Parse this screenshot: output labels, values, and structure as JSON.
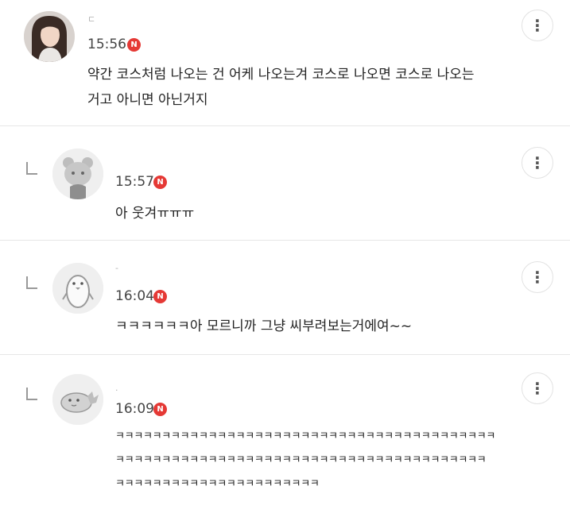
{
  "comments": [
    {
      "author": "ㄷ",
      "time": "15:56",
      "badge": "N",
      "text": "약간 코스처럼 나오는 건 어케 나오는겨 코스로 나오면 코스로 나오는\n거고 아니면 아닌거지",
      "avatar": "profile-photo"
    },
    {
      "author": "",
      "time": "15:57",
      "badge": "N",
      "text": "아 웃겨ㅠㅠㅠ",
      "avatar": "bear-character"
    },
    {
      "author": "-",
      "time": "16:04",
      "badge": "N",
      "text": "ㅋㅋㅋㅋㅋㅋ아 모르니까 그냥 씨부려보는거에여~~",
      "avatar": "penguin-character"
    },
    {
      "author": "·",
      "time": "16:09",
      "badge": "N",
      "text": "ㅋㅋㅋㅋㅋㅋㅋㅋㅋㅋㅋㅋㅋㅋㅋㅋㅋㅋㅋㅋㅋㅋㅋㅋㅋㅋㅋㅋㅋㅋㅋㅋㅋㅋㅋㅋㅋㅋㅋㅋㅋ\nㅋㅋㅋㅋㅋㅋㅋㅋㅋㅋㅋㅋㅋㅋㅋㅋㅋㅋㅋㅋㅋㅋㅋㅋㅋㅋㅋㅋㅋㅋㅋㅋㅋㅋㅋㅋㅋㅋㅋㅋ\nㅋㅋㅋㅋㅋㅋㅋㅋㅋㅋㅋㅋㅋㅋㅋㅋㅋㅋㅋㅋㅋㅋ",
      "avatar": "dinosaur-character"
    }
  ],
  "icons": {
    "more": "more-vertical-icon",
    "reply": "reply-corner-icon"
  },
  "colors": {
    "badge": "#e53935",
    "divider": "#e6e6e6"
  }
}
